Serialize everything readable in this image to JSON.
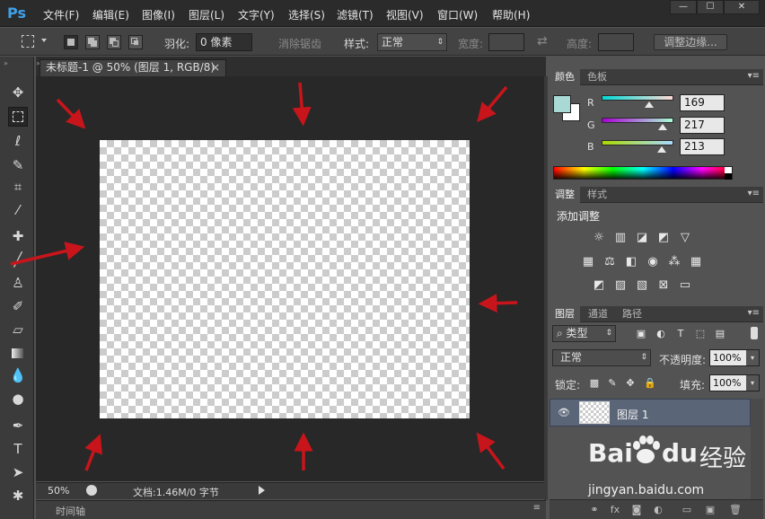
{
  "menu": {
    "logo": "Ps",
    "items": [
      "文件(F)",
      "编辑(E)",
      "图像(I)",
      "图层(L)",
      "文字(Y)",
      "选择(S)",
      "滤镜(T)",
      "视图(V)",
      "窗口(W)",
      "帮助(H)"
    ],
    "window_buttons": [
      "—",
      "☐",
      "✕"
    ]
  },
  "options": {
    "feather_label": "羽化:",
    "feather_value": "0 像素",
    "antialias_label": "消除锯齿",
    "style_label": "样式:",
    "style_value": "正常",
    "width_label": "宽度:",
    "height_label": "高度:",
    "refine_label": "调整边缘..."
  },
  "document": {
    "tab_title": "未标题-1 @ 50% (图层 1, RGB/8)",
    "tab_close": "×",
    "zoom": "50%",
    "doc_info": "文档:1.46M/0 字节",
    "timeline_label": "时间轴"
  },
  "color_panel": {
    "tabs": [
      "颜色",
      "色板"
    ],
    "channels": [
      {
        "label": "R",
        "value": "169",
        "gradient": [
          "#00d9d5",
          "#ffd9d5"
        ],
        "fraction": 0.663
      },
      {
        "label": "G",
        "value": "217",
        "gradient": [
          "#a900d5",
          "#a9ffd5"
        ],
        "fraction": 0.851
      },
      {
        "label": "B",
        "value": "213",
        "gradient": [
          "#a9d900",
          "#a9d9ff"
        ],
        "fraction": 0.835
      }
    ],
    "fg_color": "#a9d9d5",
    "bg_color": "#ffffff"
  },
  "adjust_panel": {
    "tabs": [
      "调整",
      "样式"
    ],
    "title": "添加调整"
  },
  "layers_panel": {
    "tabs": [
      "图层",
      "通道",
      "路径"
    ],
    "filter_kind": "类型",
    "blend_mode": "正常",
    "opacity_label": "不透明度:",
    "opacity_value": "100%",
    "lock_label": "锁定:",
    "fill_label": "填充:",
    "fill_value": "100%",
    "layer_name": "图层 1"
  },
  "watermark": {
    "brand": "Bai",
    "brand2": "du",
    "brand_cn": "经验",
    "url": "jingyan.baidu.com"
  },
  "colors": {
    "accent_blue": "#3fa1e8",
    "annotation_red": "#c8151b"
  }
}
